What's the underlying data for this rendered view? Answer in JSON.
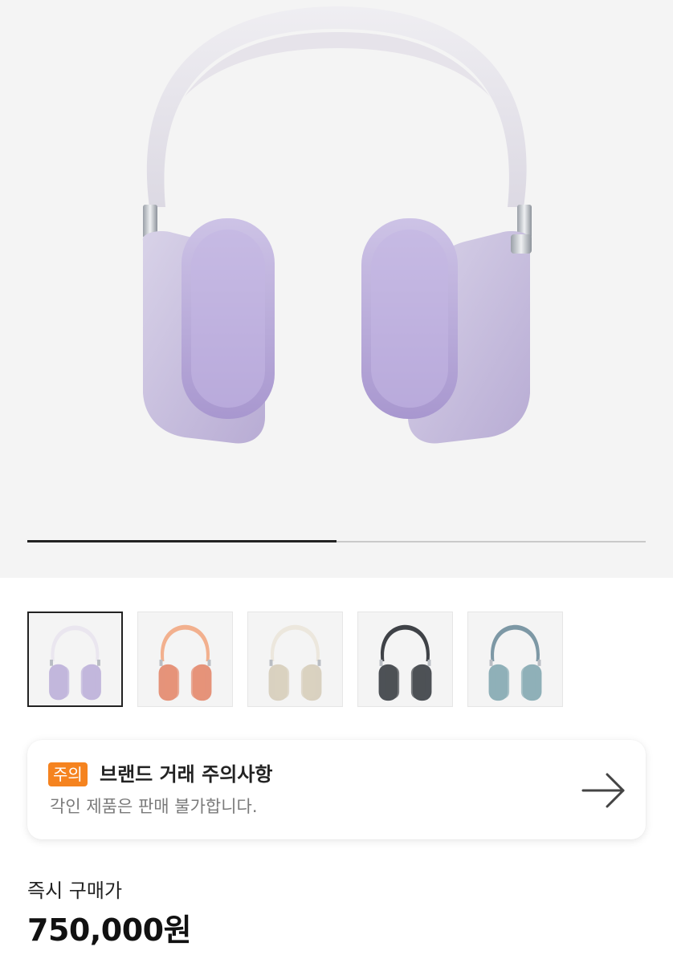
{
  "product": {
    "image_name": "AirPods Max purple headphones",
    "gallery_progress": 0.5
  },
  "color_options": [
    {
      "name": "purple-thumb",
      "band": "#eae6ef",
      "cup": "#c2b7dc",
      "selected": true
    },
    {
      "name": "pink-thumb",
      "band": "#f2b08e",
      "cup": "#e5937a",
      "selected": false
    },
    {
      "name": "starlight-thumb",
      "band": "#ece7dd",
      "cup": "#d9d1c0",
      "selected": false
    },
    {
      "name": "space-gray-thumb",
      "band": "#3f4247",
      "cup": "#4d5156",
      "selected": false
    },
    {
      "name": "sky-blue-thumb",
      "band": "#7d98a5",
      "cup": "#8fb0b8",
      "selected": false
    }
  ],
  "notice": {
    "badge": "주의",
    "title": "브랜드 거래 주의사항",
    "subtitle": "각인 제품은 판매 불가합니다.",
    "icon": "arrow-right-icon"
  },
  "price": {
    "label": "즉시 구매가",
    "value": "750,000원"
  },
  "colors": {
    "badge": "#f5831f",
    "hero_bg": "#f4f4f4"
  }
}
